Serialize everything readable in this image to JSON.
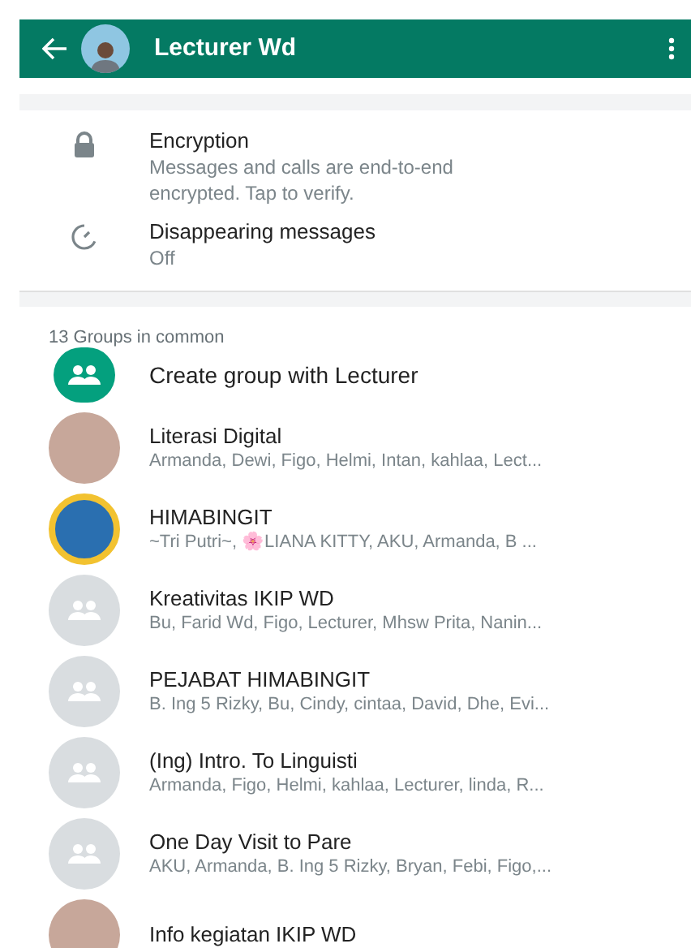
{
  "header": {
    "title": "Lecturer Wd"
  },
  "info_items": [
    {
      "kind": "encryption",
      "title": "Encryption",
      "subtitle": "Messages and calls are end-to-end encrypted. Tap to verify."
    },
    {
      "kind": "disappearing",
      "title": "Disappearing messages",
      "subtitle": "Off"
    }
  ],
  "groups_section": {
    "heading": "13 Groups in common",
    "create_label": "Create group with Lecturer",
    "groups": [
      {
        "name": "Literasi Digital",
        "members": "Armanda, Dewi, Figo, Helmi, Intan, kahlaa, Lect...",
        "kind": "photo"
      },
      {
        "name": "HIMABINGIT",
        "members": "~Tri Putri~, 🌸LIANA KITTY, AKU, Armanda, B ...",
        "kind": "logo"
      },
      {
        "name": "Kreativitas IKIP WD",
        "members": "Bu, Farid Wd, Figo, Lecturer, Mhsw Prita, Nanin...",
        "kind": "default"
      },
      {
        "name": "PEJABAT HIMABINGIT",
        "members": "B. Ing 5 Rizky, Bu, Cindy, cintaa, David, Dhe, Evi...",
        "kind": "default"
      },
      {
        "name": "(Ing) Intro. To Linguisti",
        "members": "Armanda, Figo, Helmi, kahlaa, Lecturer, linda, R...",
        "kind": "default"
      },
      {
        "name": "One Day Visit to Pare",
        "members": "AKU, Armanda, B. Ing 5 Rizky, Bryan, Febi, Figo,...",
        "kind": "default"
      },
      {
        "name": "Info kegiatan IKIP WD",
        "kind": "photo"
      }
    ]
  }
}
